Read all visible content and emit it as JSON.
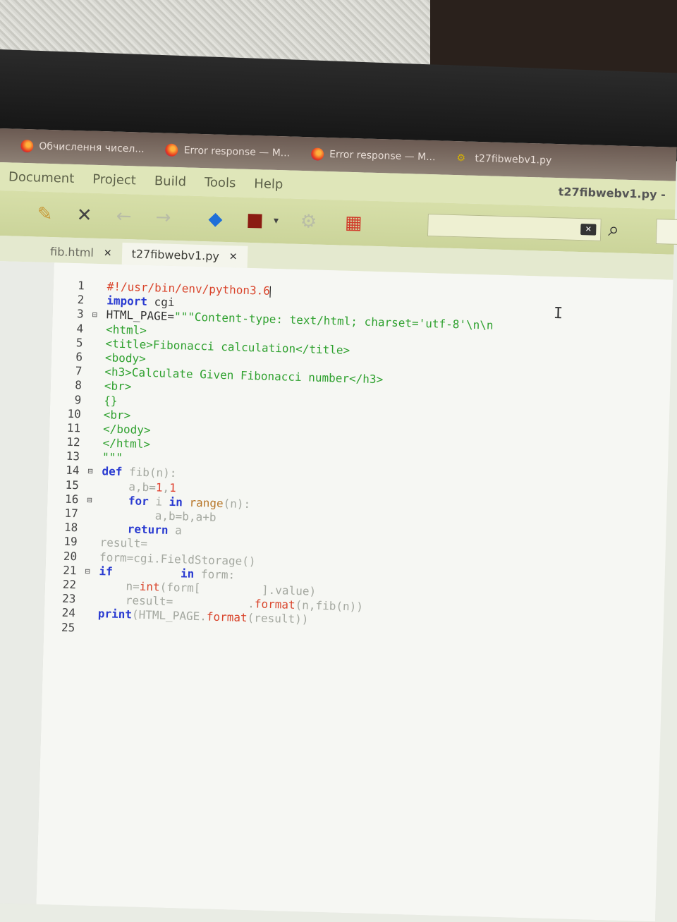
{
  "browser_tabs": [
    {
      "label": "Обчислення чисел...",
      "icon": "firefox-icon"
    },
    {
      "label": "Error response — M...",
      "icon": "firefox-icon"
    },
    {
      "label": "Error response — M...",
      "icon": "firefox-icon"
    },
    {
      "label": "t27fibwebv1.py",
      "icon": "python-icon"
    }
  ],
  "menu": [
    "Document",
    "Project",
    "Build",
    "Tools",
    "Help"
  ],
  "window_title": "t27fibwebv1.py -",
  "toolbar_icons": [
    "save-icon",
    "close-icon",
    "back-icon",
    "forward-icon",
    "compile-icon",
    "build-icon",
    "dropdown-icon",
    "run-icon",
    "color-chooser-icon"
  ],
  "search": {
    "placeholder": ""
  },
  "doc_tabs": [
    {
      "label": "fib.html",
      "active": false
    },
    {
      "label": "t27fibwebv1.py",
      "active": true
    }
  ],
  "code_lines": [
    [
      {
        "t": "comment",
        "v": "#!/usr/bin/env/python3.6"
      }
    ],
    [
      {
        "t": "kw",
        "v": "import"
      },
      {
        "t": "id",
        "v": " cgi"
      }
    ],
    [
      {
        "t": "id",
        "v": "HTML_PAGE="
      },
      {
        "t": "str",
        "v": "\"\"\"Content-type: text/html; charset='utf-8'\\n\\n"
      }
    ],
    [
      {
        "t": "str",
        "v": "<html>"
      }
    ],
    [
      {
        "t": "str",
        "v": "<title>Fibonacci calculation</title>"
      }
    ],
    [
      {
        "t": "str",
        "v": "<body>"
      }
    ],
    [
      {
        "t": "str",
        "v": "<h3>Calculate Given Fibonacci number</h3>"
      }
    ],
    [
      {
        "t": "str",
        "v": "<br>"
      }
    ],
    [
      {
        "t": "str",
        "v": "{}"
      }
    ],
    [
      {
        "t": "str",
        "v": "<br>"
      }
    ],
    [
      {
        "t": "str",
        "v": "</body>"
      }
    ],
    [
      {
        "t": "str",
        "v": "</html>"
      }
    ],
    [
      {
        "t": "str",
        "v": "\"\"\""
      }
    ],
    [
      {
        "t": "kw",
        "v": "def"
      },
      {
        "t": "faint",
        "v": " fib(n):"
      }
    ],
    [
      {
        "t": "faint",
        "v": "    a,b="
      },
      {
        "t": "num",
        "v": "1"
      },
      {
        "t": "faint",
        "v": ","
      },
      {
        "t": "num",
        "v": "1"
      }
    ],
    [
      {
        "t": "kw",
        "v": "    for"
      },
      {
        "t": "faint",
        "v": " i "
      },
      {
        "t": "kw",
        "v": "in"
      },
      {
        "t": "fn",
        "v": " range"
      },
      {
        "t": "faint",
        "v": "(n):"
      }
    ],
    [
      {
        "t": "faint",
        "v": "        a,b=b,a+b"
      }
    ],
    [
      {
        "t": "kw",
        "v": "    return"
      },
      {
        "t": "faint",
        "v": " a"
      }
    ],
    [
      {
        "t": "faint",
        "v": "result="
      }
    ],
    [
      {
        "t": "faint",
        "v": "form=cgi.FieldStorage()"
      }
    ],
    [
      {
        "t": "kw",
        "v": "if"
      },
      {
        "t": "faint",
        "v": "          "
      },
      {
        "t": "kw",
        "v": "in"
      },
      {
        "t": "faint",
        "v": " form:"
      }
    ],
    [
      {
        "t": "faint",
        "v": "    n="
      },
      {
        "t": "red",
        "v": "int"
      },
      {
        "t": "faint",
        "v": "(form[         ].value)"
      }
    ],
    [
      {
        "t": "faint",
        "v": "    result=           ."
      },
      {
        "t": "red",
        "v": "format"
      },
      {
        "t": "faint",
        "v": "(n,fib(n))"
      }
    ],
    [
      {
        "t": "kw",
        "v": "print"
      },
      {
        "t": "faint",
        "v": "(HTML_PAGE."
      },
      {
        "t": "red",
        "v": "format"
      },
      {
        "t": "faint",
        "v": "(result))"
      }
    ],
    []
  ],
  "fold_markers": {
    "3": "⊟",
    "14": "⊟",
    "16": "⊟",
    "21": "⊟"
  }
}
